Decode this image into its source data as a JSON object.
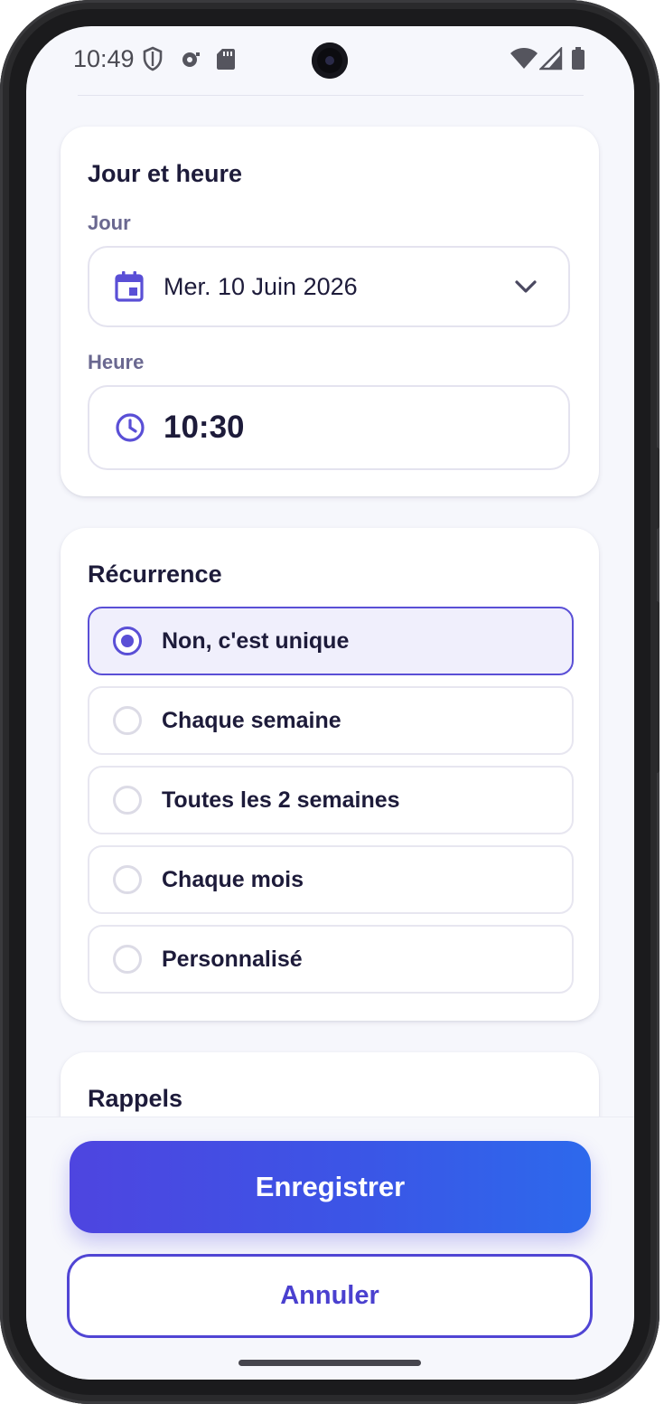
{
  "status_bar": {
    "time": "10:49",
    "icons": [
      "shield-icon",
      "cast-icon",
      "sd-card-icon",
      "wifi-icon",
      "signal-icon",
      "battery-icon"
    ]
  },
  "schedule_card": {
    "title": "Jour et heure",
    "day_label": "Jour",
    "day_value": "Mer. 10 Juin 2026",
    "time_label": "Heure",
    "time_value": "10:30"
  },
  "recurrence_card": {
    "title": "Récurrence",
    "options": [
      {
        "label": "Non, c'est unique",
        "selected": true
      },
      {
        "label": "Chaque semaine",
        "selected": false
      },
      {
        "label": "Toutes les 2 semaines",
        "selected": false
      },
      {
        "label": "Chaque mois",
        "selected": false
      },
      {
        "label": "Personnalisé",
        "selected": false
      }
    ]
  },
  "reminders_card": {
    "title": "Rappels"
  },
  "actions": {
    "save_label": "Enregistrer",
    "cancel_label": "Annuler"
  },
  "colors": {
    "accent": "#5a4fd6",
    "gradient_start": "#4e45e0",
    "gradient_end": "#2d69ec",
    "text_primary": "#1d1b3a",
    "text_label": "#6a6890",
    "screen_bg": "#f6f7fc"
  }
}
